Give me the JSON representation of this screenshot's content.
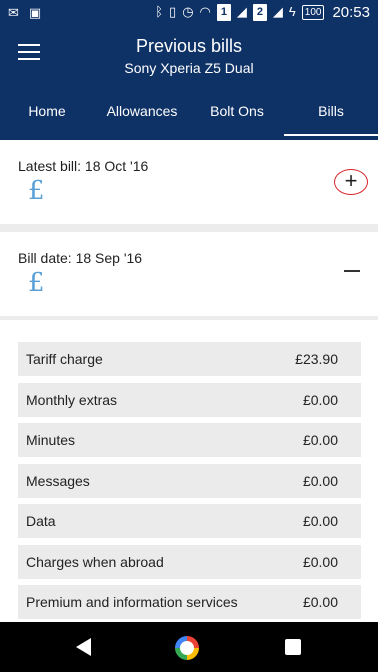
{
  "status_bar": {
    "time": "20:53",
    "battery": "100",
    "sim1": "1",
    "sim2": "2",
    "icons": [
      "mail-icon",
      "image-icon",
      "bluetooth-icon",
      "vibrate-icon",
      "alarm-icon",
      "wifi-icon",
      "signal-icon",
      "charging-icon"
    ]
  },
  "appbar": {
    "title": "Previous bills",
    "subtitle": "Sony Xperia Z5 Dual"
  },
  "tabs": [
    {
      "label": "Home",
      "active": false
    },
    {
      "label": "Allowances",
      "active": false
    },
    {
      "label": "Bolt Ons",
      "active": false
    },
    {
      "label": "Bills",
      "active": true
    }
  ],
  "latest_bill": {
    "label": "Latest bill: 18 Oct '16",
    "currency": "£",
    "toggle": "+"
  },
  "bill_date": {
    "label": "Bill date: 18 Sep '16",
    "currency": "£"
  },
  "bill_rows": [
    {
      "label": "Tariff charge",
      "value": "£23.90"
    },
    {
      "label": "Monthly extras",
      "value": "£0.00"
    },
    {
      "label": "Minutes",
      "value": "£0.00"
    },
    {
      "label": "Messages",
      "value": "£0.00"
    },
    {
      "label": "Data",
      "value": "£0.00"
    },
    {
      "label": "Charges when abroad",
      "value": "£0.00"
    },
    {
      "label": "Premium and information services",
      "value": "£0.00"
    }
  ],
  "colors": {
    "brand": "#0e3166",
    "pound": "#5aa0d8",
    "highlight": "#d8232a"
  }
}
